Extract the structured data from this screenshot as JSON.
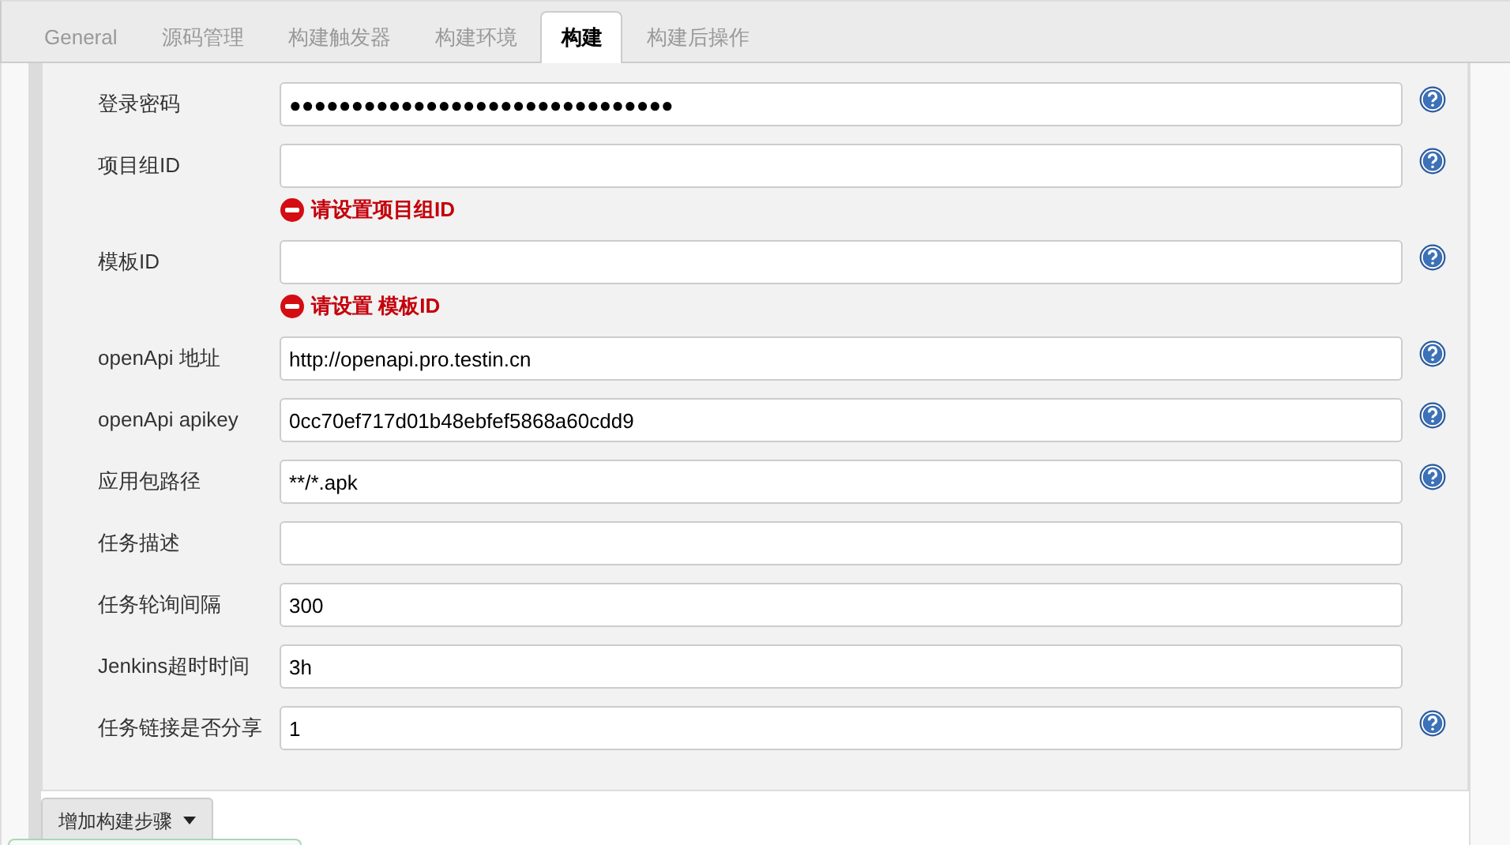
{
  "tabs": [
    {
      "label": "General",
      "selected": false
    },
    {
      "label": "源码管理",
      "selected": false
    },
    {
      "label": "构建触发器",
      "selected": false
    },
    {
      "label": "构建环境",
      "selected": false
    },
    {
      "label": "构建",
      "selected": true
    },
    {
      "label": "构建后操作",
      "selected": false
    }
  ],
  "fields": [
    {
      "label": "登录密码",
      "value": "●●●●●●●●●●●●●●●●●●●●●●●●●●●●●●●",
      "help": true
    },
    {
      "label": "项目组ID",
      "help": true,
      "error": "请设置项目组ID"
    },
    {
      "label": "模板ID",
      "help": true,
      "error": "请设置 模板ID"
    },
    {
      "label": "openApi 地址",
      "value": "http://openapi.pro.testin.cn",
      "help": true
    },
    {
      "label": "openApi apikey",
      "value": "0cc70ef717d01b48ebfef5868a60cdd9",
      "help": true
    },
    {
      "label": "应用包路径",
      "value": "**/*.apk",
      "help": true
    },
    {
      "label": "任务描述",
      "help": false
    },
    {
      "label": "任务轮询间隔",
      "value": "300",
      "help": false
    },
    {
      "label": "Jenkins超时时间",
      "value": "3h",
      "help": false
    },
    {
      "label": "任务链接是否分享",
      "value": "1",
      "help": true
    }
  ],
  "add_step_button": "增加构建步骤"
}
